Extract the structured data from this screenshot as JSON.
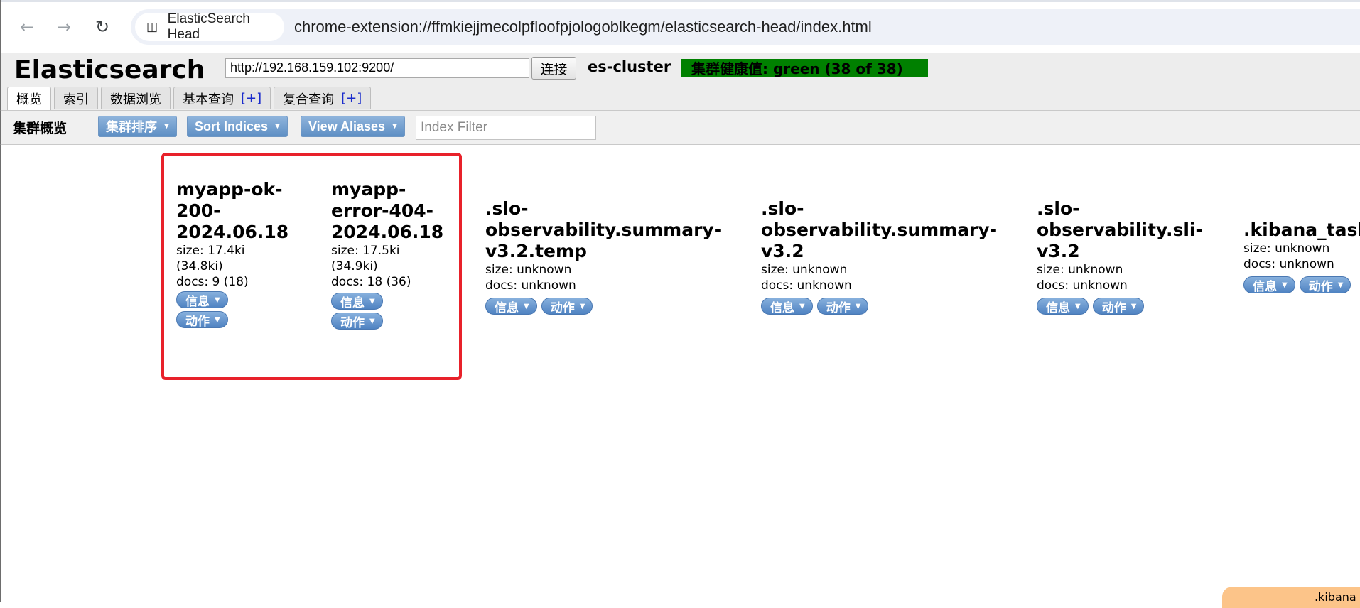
{
  "browser": {
    "back_icon": "arrow-left-icon",
    "forward_icon": "arrow-right-icon",
    "reload_icon": "reload-icon",
    "site_label": "ElasticSearch Head",
    "url": "chrome-extension://ffmkiejjmecolpfloofpjologoblkegm/elasticsearch-head/index.html"
  },
  "header": {
    "logo": "Elasticsearch",
    "connect_url": "http://192.168.159.102:9200/",
    "connect_label": "连接",
    "cluster_name": "es-cluster",
    "health": "集群健康值: green (38 of 38)",
    "health_color": "#008000"
  },
  "tabs": [
    {
      "label": "概览",
      "plus": ""
    },
    {
      "label": "索引",
      "plus": ""
    },
    {
      "label": "数据浏览",
      "plus": ""
    },
    {
      "label": "基本查询",
      "plus": "[+]"
    },
    {
      "label": "复合查询",
      "plus": "[+]"
    }
  ],
  "toolbar": {
    "title": "集群概览",
    "cluster_sort": "集群排序",
    "sort_indices": "Sort Indices",
    "view_aliases": "View Aliases",
    "filter_placeholder": "Index Filter"
  },
  "indices": [
    {
      "name": "myapp-ok-\n200-\n2024.06.18",
      "size": "size: 17.4ki\n(34.8ki)",
      "docs": "docs: 9 (18)",
      "info": "信息",
      "action": "动作"
    },
    {
      "name": "myapp-\nerror-404-\n2024.06.18",
      "size": "size: 17.5ki\n(34.9ki)",
      "docs": "docs: 18 (36)",
      "info": "信息",
      "action": "动作"
    },
    {
      "name": ".slo-\nobservability.summary-\nv3.2.temp",
      "size": "size: unknown",
      "docs": "docs: unknown",
      "info": "信息",
      "action": "动作"
    },
    {
      "name": ".slo-\nobservability.summary-\nv3.2",
      "size": "size: unknown",
      "docs": "docs: unknown",
      "info": "信息",
      "action": "动作"
    },
    {
      "name": ".slo-\nobservability.sli-\nv3.2",
      "size": "size: unknown",
      "docs": "docs: unknown",
      "info": "信息",
      "action": "动作"
    },
    {
      "name": ".kibana_tasl",
      "size": "size: unknown",
      "docs": "docs: unknown",
      "info": "信息",
      "action": "动作"
    }
  ],
  "footer_chip": ".kibana",
  "colors": {
    "highlight": "#e8212a",
    "pill": "#4f83c2",
    "chip": "#fcc489"
  }
}
